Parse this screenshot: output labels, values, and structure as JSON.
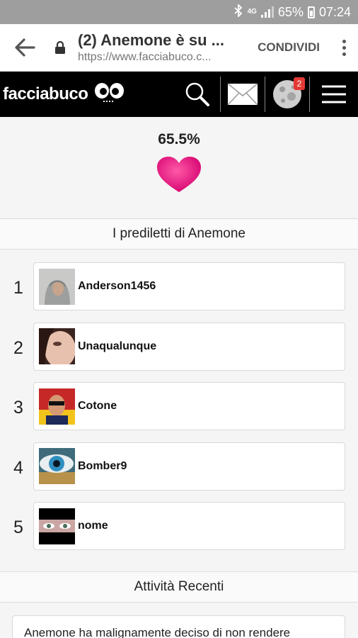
{
  "status_bar": {
    "network": "4G",
    "battery": "65%",
    "time": "07:24"
  },
  "browser": {
    "title": "(2) Anemone è su ...",
    "url": "https://www.facciabuco.c...",
    "share_label": "CONDIVIDI"
  },
  "site": {
    "logo": "facciabuco",
    "notification_count": "2"
  },
  "profile": {
    "score": "65.5%",
    "heart_color": "#e8177f"
  },
  "favorites": {
    "title": "I prediletti di Anemone",
    "items": [
      {
        "rank": "1",
        "name": "Anderson1456"
      },
      {
        "rank": "2",
        "name": "Unaqualunque"
      },
      {
        "rank": "3",
        "name": "Cotone"
      },
      {
        "rank": "4",
        "name": "Bomber9"
      },
      {
        "rank": "5",
        "name": "nome"
      }
    ]
  },
  "activity": {
    "title": "Attività Recenti",
    "first_text": "Anemone ha malignamente deciso di non rendere"
  }
}
